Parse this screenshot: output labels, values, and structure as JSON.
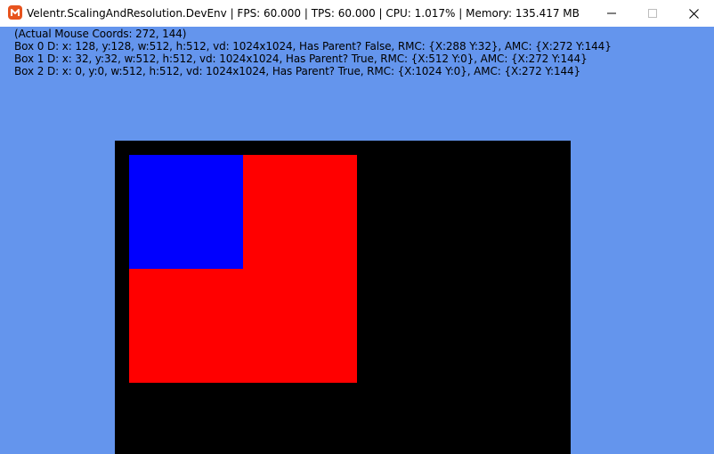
{
  "window": {
    "title": "Velentr.ScalingAndResolution.DevEnv | FPS: 60.000 | TPS: 60.000 | CPU: 1.017% | Memory: 135.417 MB",
    "app_icon": "monogame-logo-icon",
    "controls": {
      "minimize": "minimize-icon",
      "maximize": "maximize-icon",
      "close": "close-icon"
    }
  },
  "debug": {
    "mouse_coords": "(Actual Mouse Coords: 272, 144)",
    "box0": "Box 0 D: x: 128, y:128, w:512, h:512, vd: 1024x1024, Has Parent? False, RMC: {X:288 Y:32}, AMC: {X:272 Y:144}",
    "box1": "Box 1 D: x: 32, y:32, w:512, h:512, vd: 1024x1024, Has Parent? True, RMC: {X:512 Y:0}, AMC: {X:272 Y:144}",
    "box2": "Box 2 D: x: 0, y:0, w:512, h:512, vd: 1024x1024, Has Parent? True, RMC: {X:1024 Y:0}, AMC: {X:272 Y:144}"
  },
  "colors": {
    "background": "#6495ed",
    "viewport": "#000000",
    "box0": "#ff0000",
    "box1": "#0000ff",
    "app_icon": "#e7531e"
  }
}
